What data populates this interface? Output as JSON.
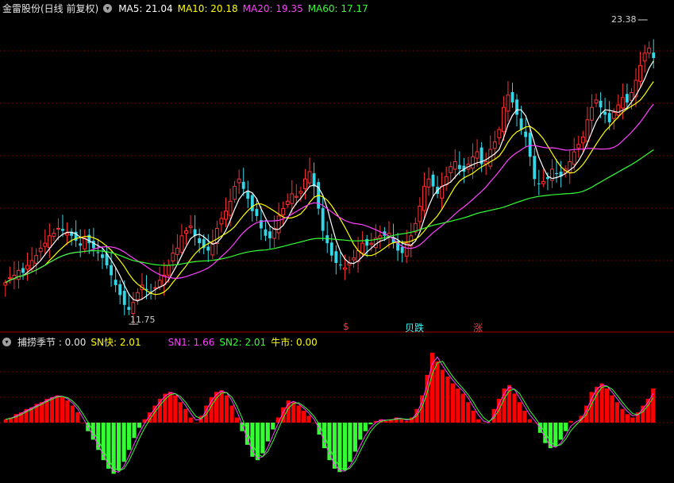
{
  "header": {
    "stock_title": "金雷股份(日线 前复权)",
    "ma": [
      {
        "label": "MA5: 21.04",
        "color": "#ffffff"
      },
      {
        "label": "MA10: 20.18",
        "color": "#ffff00"
      },
      {
        "label": "MA20: 19.35",
        "color": "#ff40ff"
      },
      {
        "label": "MA60: 17.17",
        "color": "#33ff33"
      }
    ]
  },
  "sub_header": {
    "indicator_title": "捕捞季节 : 0.00",
    "items": [
      {
        "label": "SN快: 2.01",
        "color": "#ffff00"
      },
      {
        "label": "SN1: 1.66",
        "color": "#ff40ff"
      },
      {
        "label": "SN2: 2.01",
        "color": "#33ff33"
      },
      {
        "label": "牛市: 0.00",
        "color": "#ffff00"
      }
    ]
  },
  "markers": {
    "high": "23.38",
    "low": "11.75"
  },
  "signals": [
    {
      "label": "$",
      "color": "#ff3333"
    },
    {
      "label": "贝跌",
      "color": "#33ffff"
    },
    {
      "label": "涨",
      "color": "#ff3333"
    }
  ],
  "colors": {
    "up": "#ff3030",
    "down": "#33d6e6",
    "grid": "#7a0000",
    "histo_pos": "#ff0000",
    "histo_neg": "#33ff33"
  },
  "chart_data": [
    {
      "type": "candlestick",
      "title": "金雷股份(日线 前复权)",
      "y_range": [
        11,
        24
      ],
      "close": [
        13.0,
        13.2,
        13.3,
        13.5,
        13.4,
        13.7,
        13.9,
        14.1,
        14.4,
        14.6,
        14.9,
        15.0,
        15.2,
        15.1,
        15.0,
        14.9,
        14.7,
        14.5,
        14.8,
        14.6,
        14.4,
        14.2,
        14.0,
        13.7,
        13.3,
        12.9,
        12.5,
        12.1,
        11.9,
        12.2,
        12.6,
        12.9,
        12.7,
        12.6,
        12.8,
        13.1,
        13.3,
        13.7,
        14.2,
        14.4,
        14.9,
        15.1,
        15.3,
        14.9,
        14.6,
        14.4,
        14.3,
        14.6,
        15.2,
        15.6,
        15.9,
        16.3,
        16.9,
        17.2,
        16.8,
        16.4,
        15.9,
        15.7,
        15.2,
        14.9,
        14.8,
        15.2,
        15.7,
        16.0,
        16.3,
        16.6,
        16.5,
        16.7,
        17.2,
        17.5,
        16.9,
        16.0,
        15.1,
        14.6,
        14.1,
        13.8,
        13.7,
        13.6,
        13.8,
        14.0,
        14.3,
        14.6,
        14.5,
        14.6,
        14.8,
        14.9,
        14.9,
        15.0,
        14.6,
        14.3,
        14.2,
        14.6,
        14.9,
        15.4,
        16.1,
        16.9,
        17.2,
        16.9,
        16.6,
        16.9,
        17.3,
        17.7,
        17.9,
        17.6,
        17.5,
        17.8,
        18.1,
        18.3,
        17.8,
        17.9,
        18.4,
        18.7,
        19.2,
        20.1,
        20.6,
        20.3,
        19.8,
        19.2,
        18.9,
        18.1,
        17.2,
        17.0,
        17.1,
        17.2,
        17.6,
        17.4,
        17.3,
        17.6,
        17.9,
        18.3,
        18.6,
        18.9,
        19.6,
        20.1,
        20.4,
        20.1,
        19.8,
        19.5,
        19.9,
        20.2,
        20.5,
        20.3,
        20.7,
        21.2,
        21.8,
        22.3,
        22.5,
        22.1
      ]
    },
    {
      "type": "bar",
      "title": "捕捞季节",
      "series": [
        {
          "name": "SN快",
          "values": [
            0.2,
            0.3,
            0.5,
            0.6,
            0.8,
            0.9,
            1.1,
            1.2,
            1.4,
            1.5,
            1.6,
            1.5,
            1.3,
            1.0,
            0.6,
            0.0,
            -0.5,
            -1.0,
            -1.6,
            -2.2,
            -2.7,
            -3.0,
            -2.8,
            -2.3,
            -1.6,
            -0.9,
            -0.3,
            0.2,
            0.6,
            1.0,
            1.4,
            1.7,
            1.8,
            1.6,
            1.2,
            0.8,
            0.3,
            0.0,
            0.4,
            1.0,
            1.5,
            1.8,
            1.9,
            1.6,
            1.0,
            0.3,
            -0.5,
            -1.3,
            -2.0,
            -2.2,
            -1.8,
            -1.1,
            -0.4,
            0.3,
            0.9,
            1.3,
            1.2,
            1.0,
            0.7,
            0.4,
            0.0,
            -0.7,
            -1.5,
            -2.2,
            -2.7,
            -2.9,
            -2.8,
            -2.3,
            -1.7,
            -1.0,
            -0.5,
            -0.1,
            0.1,
            0.2,
            0.1,
            0.2,
            0.3,
            0.2,
            0.1,
            0.3,
            0.8,
            1.6,
            2.8,
            4.1,
            3.6,
            3.1,
            2.7,
            2.3,
            2.0,
            1.7,
            1.2,
            0.7,
            0.2,
            0.0,
            0.0,
            0.8,
            1.4,
            2.0,
            2.2,
            1.7,
            1.2,
            0.7,
            0.2,
            0.0,
            -0.6,
            -1.2,
            -1.5,
            -1.4,
            -1.0,
            -0.5,
            0.1,
            0.0,
            0.4,
            1.0,
            1.8,
            2.1,
            2.3,
            2.0,
            1.6,
            1.2,
            0.8,
            0.5,
            0.3,
            0.6,
            1.0,
            1.4,
            2.0
          ]
        },
        {
          "name": "SN1",
          "values": [
            1.66
          ]
        },
        {
          "name": "SN2",
          "values": [
            2.01
          ]
        }
      ]
    }
  ]
}
